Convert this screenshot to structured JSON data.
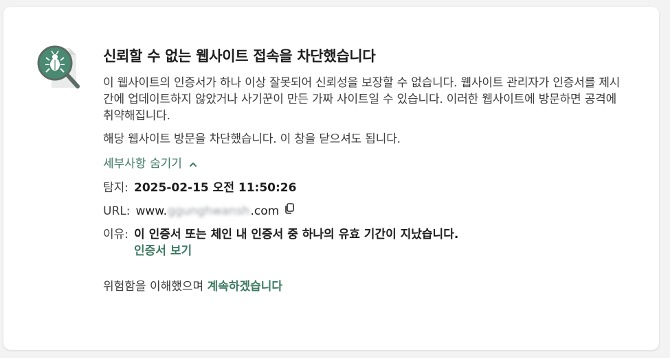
{
  "dialog": {
    "title": "신뢰할 수 없는 웹사이트 접속을 차단했습니다",
    "description": "이 웹사이트의 인증서가 하나 이상 잘못되어 신뢰성을 보장할 수 없습니다. 웹사이트 관리자가 인증서를 제시간에 업데이트하지 않았거나 사기꾼이 만든 가짜 사이트일 수 있습니다. 이러한 웹사이트에 방문하면 공격에 취약해집니다.",
    "blocked_message": "해당 웹사이트 방문을 차단했습니다. 이 창을 닫으셔도 됩니다.",
    "hide_details_label": "세부사항 숨기기"
  },
  "details": {
    "detected_label": "탐지:",
    "detected_value": "2025-02-15 오전 11:50:26",
    "url_label": "URL:",
    "url_prefix": "www.",
    "url_redacted": "ggunghwansh",
    "url_suffix": ".com",
    "reason_label": "이유:",
    "reason_value": "이 인증서 또는 체인 내 인증서 중 하나의 유효 기간이 지났습니다.",
    "view_certificate_label": "인증서 보기"
  },
  "footer": {
    "prefix": "위험함을 이해했으며 ",
    "continue_label": "계속하겠습니다"
  },
  "colors": {
    "accent": "#3d7a62",
    "icon_circle": "#4a8a72",
    "card_bg": "#ffffff",
    "page_bg": "#f3f3f3"
  },
  "icons": {
    "main": "bug-magnifier-icon",
    "toggle": "chevron-up-icon",
    "copy": "copy-icon"
  }
}
